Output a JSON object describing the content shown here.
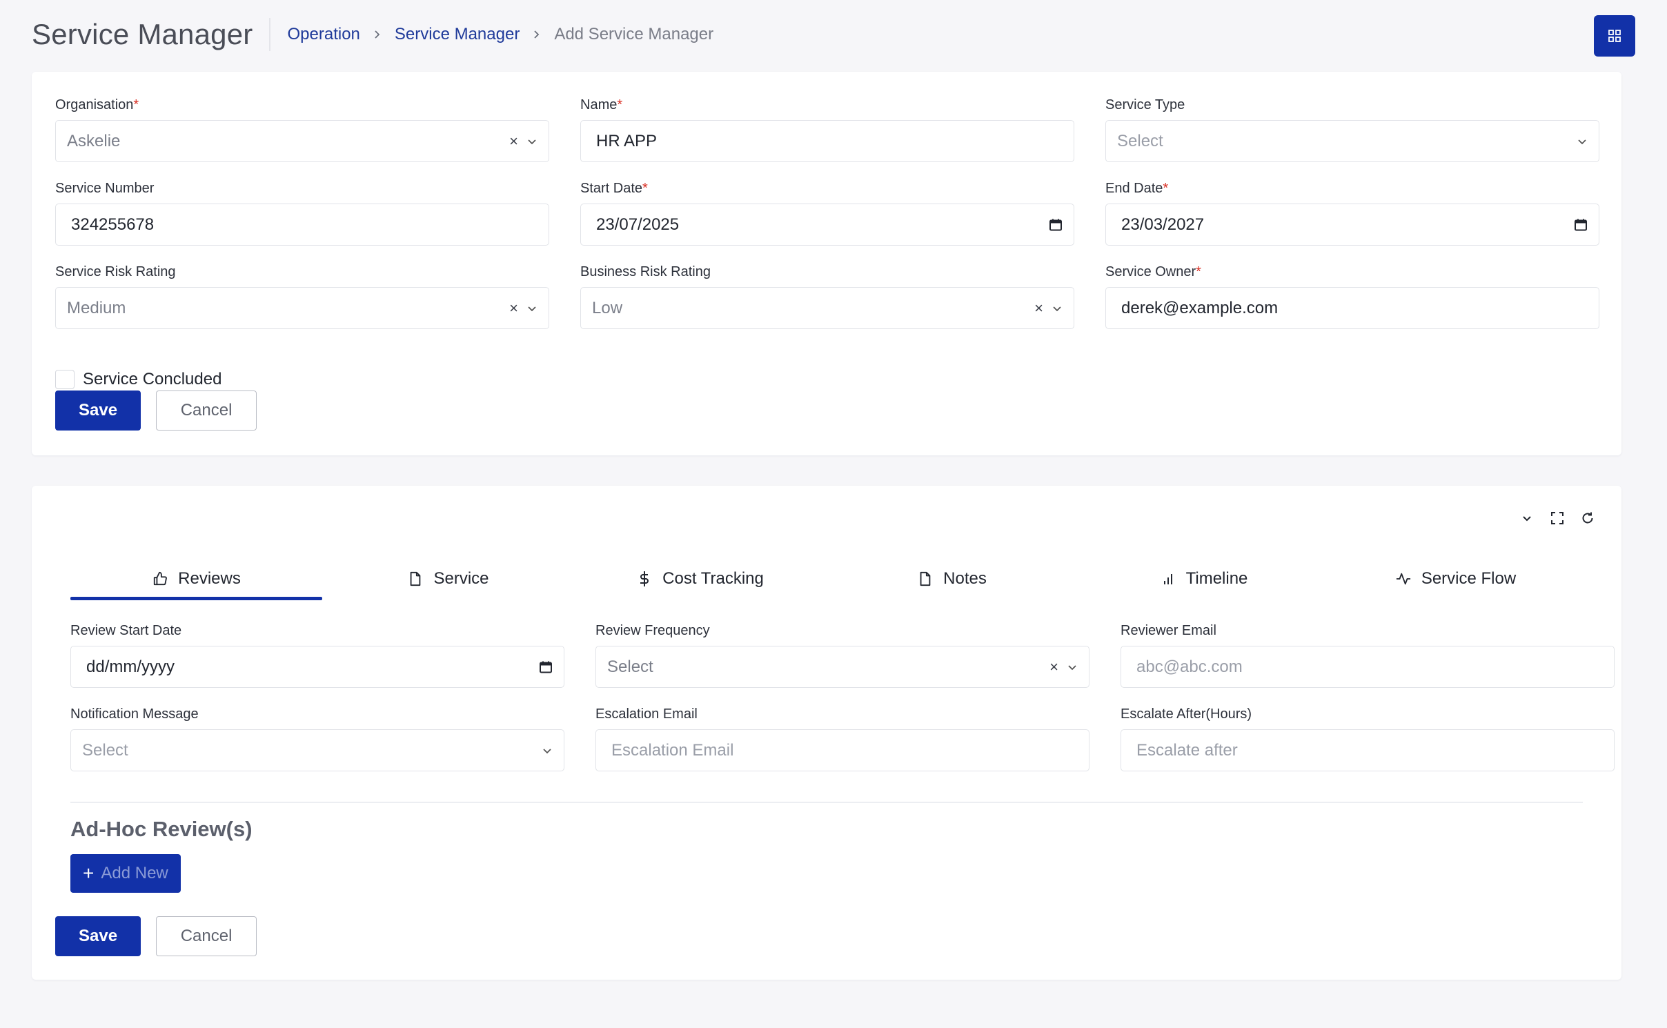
{
  "header": {
    "title": "Service Manager",
    "breadcrumb": [
      "Operation",
      "Service Manager",
      "Add Service Manager"
    ]
  },
  "form": {
    "organisation": {
      "label": "Organisation",
      "value": "Askelie"
    },
    "name": {
      "label": "Name",
      "value": "HR APP"
    },
    "service_type": {
      "label": "Service Type",
      "placeholder": "Select"
    },
    "service_number": {
      "label": "Service Number",
      "value": "324255678"
    },
    "start_date": {
      "label": "Start Date",
      "value": "23/07/2025"
    },
    "end_date": {
      "label": "End Date",
      "value": "23/03/2027"
    },
    "service_risk_rating": {
      "label": "Service Risk Rating",
      "value": "Medium"
    },
    "business_risk_rating": {
      "label": "Business Risk Rating",
      "value": "Low"
    },
    "service_owner": {
      "label": "Service Owner",
      "value": "derek@example.com"
    },
    "concluded_label": "Service Concluded",
    "save_label": "Save",
    "cancel_label": "Cancel"
  },
  "tabs": [
    {
      "label": "Reviews",
      "icon": "thumbs-up-icon",
      "active": true
    },
    {
      "label": "Service",
      "icon": "document-icon"
    },
    {
      "label": "Cost Tracking",
      "icon": "dollar-icon"
    },
    {
      "label": "Notes",
      "icon": "document-icon"
    },
    {
      "label": "Timeline",
      "icon": "bar-chart-icon"
    },
    {
      "label": "Service Flow",
      "icon": "activity-icon"
    }
  ],
  "reviews": {
    "review_start_date": {
      "label": "Review Start Date",
      "value": "dd/mm/yyyy"
    },
    "review_frequency": {
      "label": "Review Frequency",
      "placeholder": "Select"
    },
    "reviewer_email": {
      "label": "Reviewer Email",
      "placeholder": "abc@abc.com"
    },
    "notification_message": {
      "label": "Notification Message",
      "placeholder": "Select"
    },
    "escalation_email": {
      "label": "Escalation Email",
      "placeholder": "Escalation Email"
    },
    "escalate_after": {
      "label": "Escalate After(Hours)",
      "placeholder": "Escalate after"
    },
    "adhoc_title": "Ad-Hoc Review(s)",
    "add_new_label": "Add New",
    "save_label": "Save",
    "cancel_label": "Cancel"
  },
  "colors": {
    "primary": "#1231a8",
    "required": "#d93025",
    "link": "#1f3a9a"
  }
}
